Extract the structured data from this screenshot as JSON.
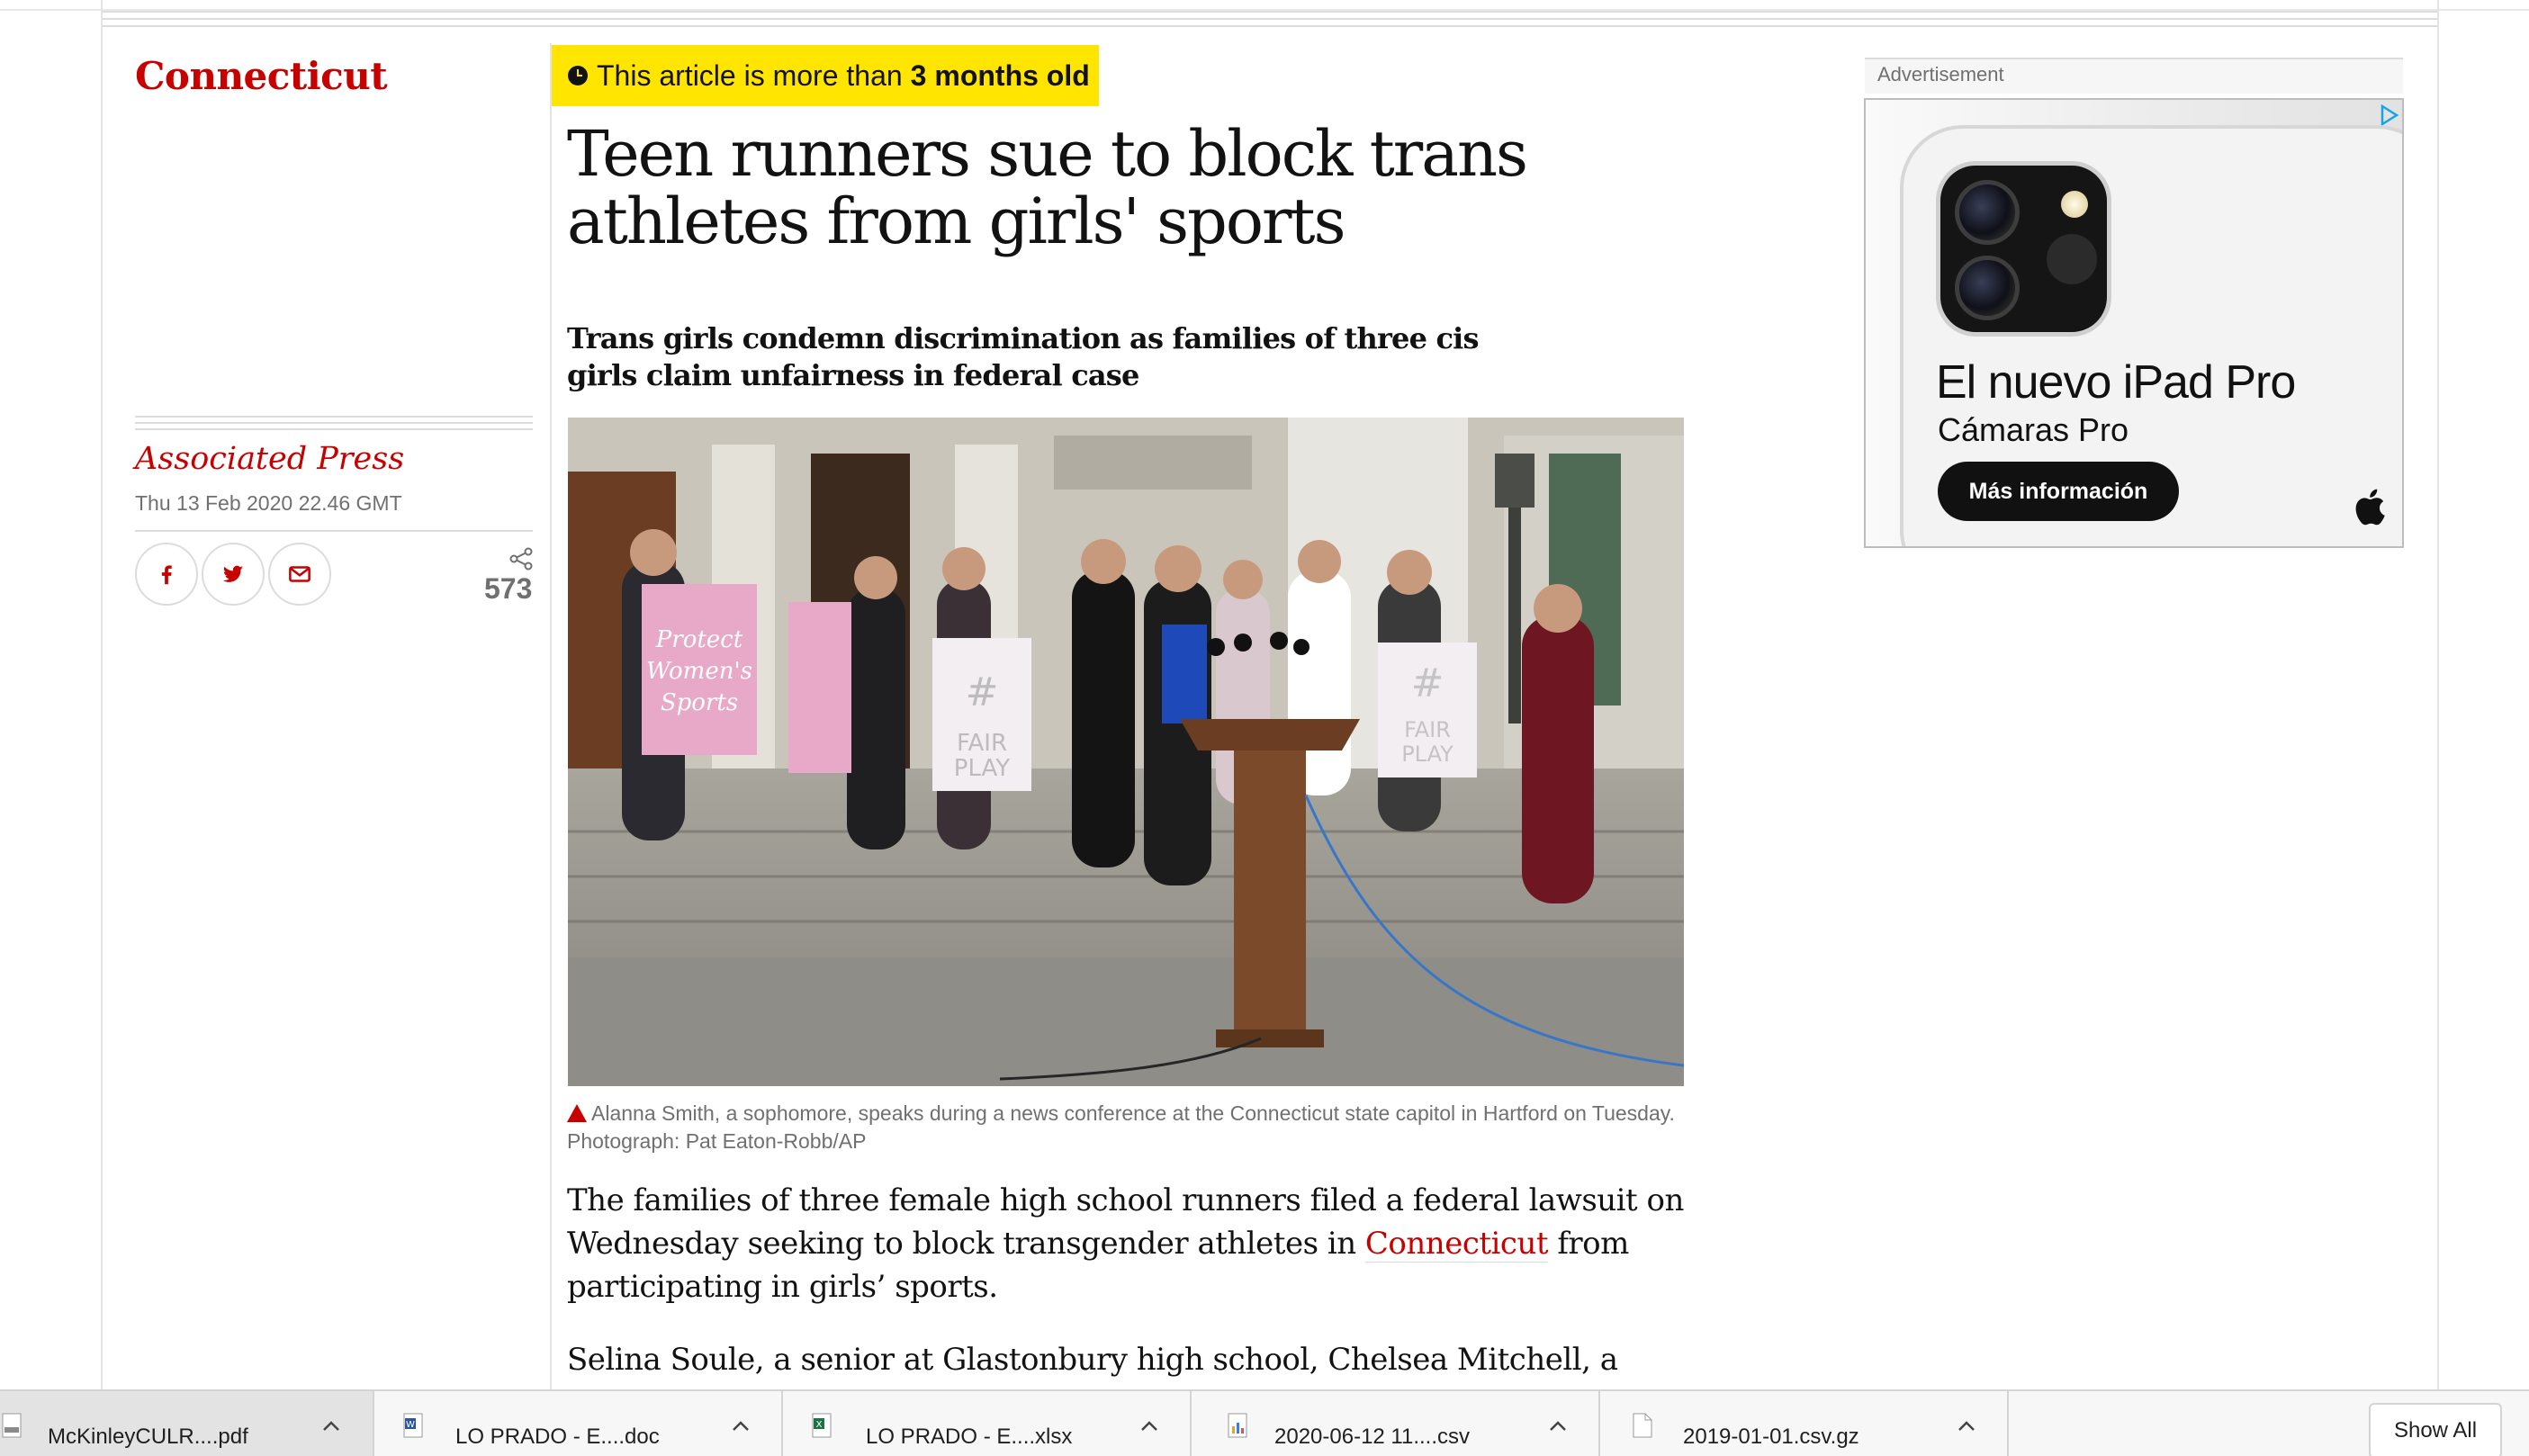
{
  "section": {
    "label": "Connecticut"
  },
  "article": {
    "age_notice": {
      "prefix": "This article is more than",
      "age": "3 months old"
    },
    "headline": "Teen runners sue to block trans athletes from girls' sports",
    "standfirst": "Trans girls condemn discrimination as families of three cis girls claim unfairness in federal case",
    "byline": "Associated Press",
    "dateline": "Thu 13 Feb 2020 22.46 GMT",
    "share": {
      "count": "573",
      "buttons": [
        "facebook-icon",
        "twitter-icon",
        "email-icon"
      ]
    },
    "photo": {
      "description_icon": "press-conference-photo",
      "signs": [
        "Protect Women's Sports",
        "#FAIR PLAY"
      ],
      "caption": "Alanna Smith, a sophomore, speaks during a news conference at the Connecticut state capitol in Hartford on Tuesday. Photograph: Pat Eaton-Robb/AP"
    },
    "body": {
      "p1_before": "The families of three female high school runners filed a federal lawsuit on Wednesday seeking to block transgender athletes in ",
      "p1_link": "Connecticut",
      "p1_after": " from participating in girls’ sports.",
      "p2": "Selina Soule, a senior at Glastonbury high school, Chelsea Mitchell, a senior"
    }
  },
  "advertisement": {
    "label": "Advertisement",
    "title": "El nuevo iPad Pro",
    "subtitle": "Cámaras Pro",
    "cta": "Más información"
  },
  "downloads": {
    "items": [
      {
        "name": "McKinleyCULR....pdf",
        "icon": "pdf-icon"
      },
      {
        "name": "LO PRADO - E....doc",
        "icon": "word-icon"
      },
      {
        "name": "LO PRADO  - E....xlsx",
        "icon": "excel-icon"
      },
      {
        "name": "2020-06-12 11....csv",
        "icon": "csv-icon"
      },
      {
        "name": "2019-01-01.csv.gz",
        "icon": "file-icon"
      }
    ],
    "show_all": "Show All"
  },
  "colors": {
    "brand_red": "#c70000",
    "badge_yellow": "#ffe500",
    "text": "#121212",
    "muted": "#707070"
  }
}
